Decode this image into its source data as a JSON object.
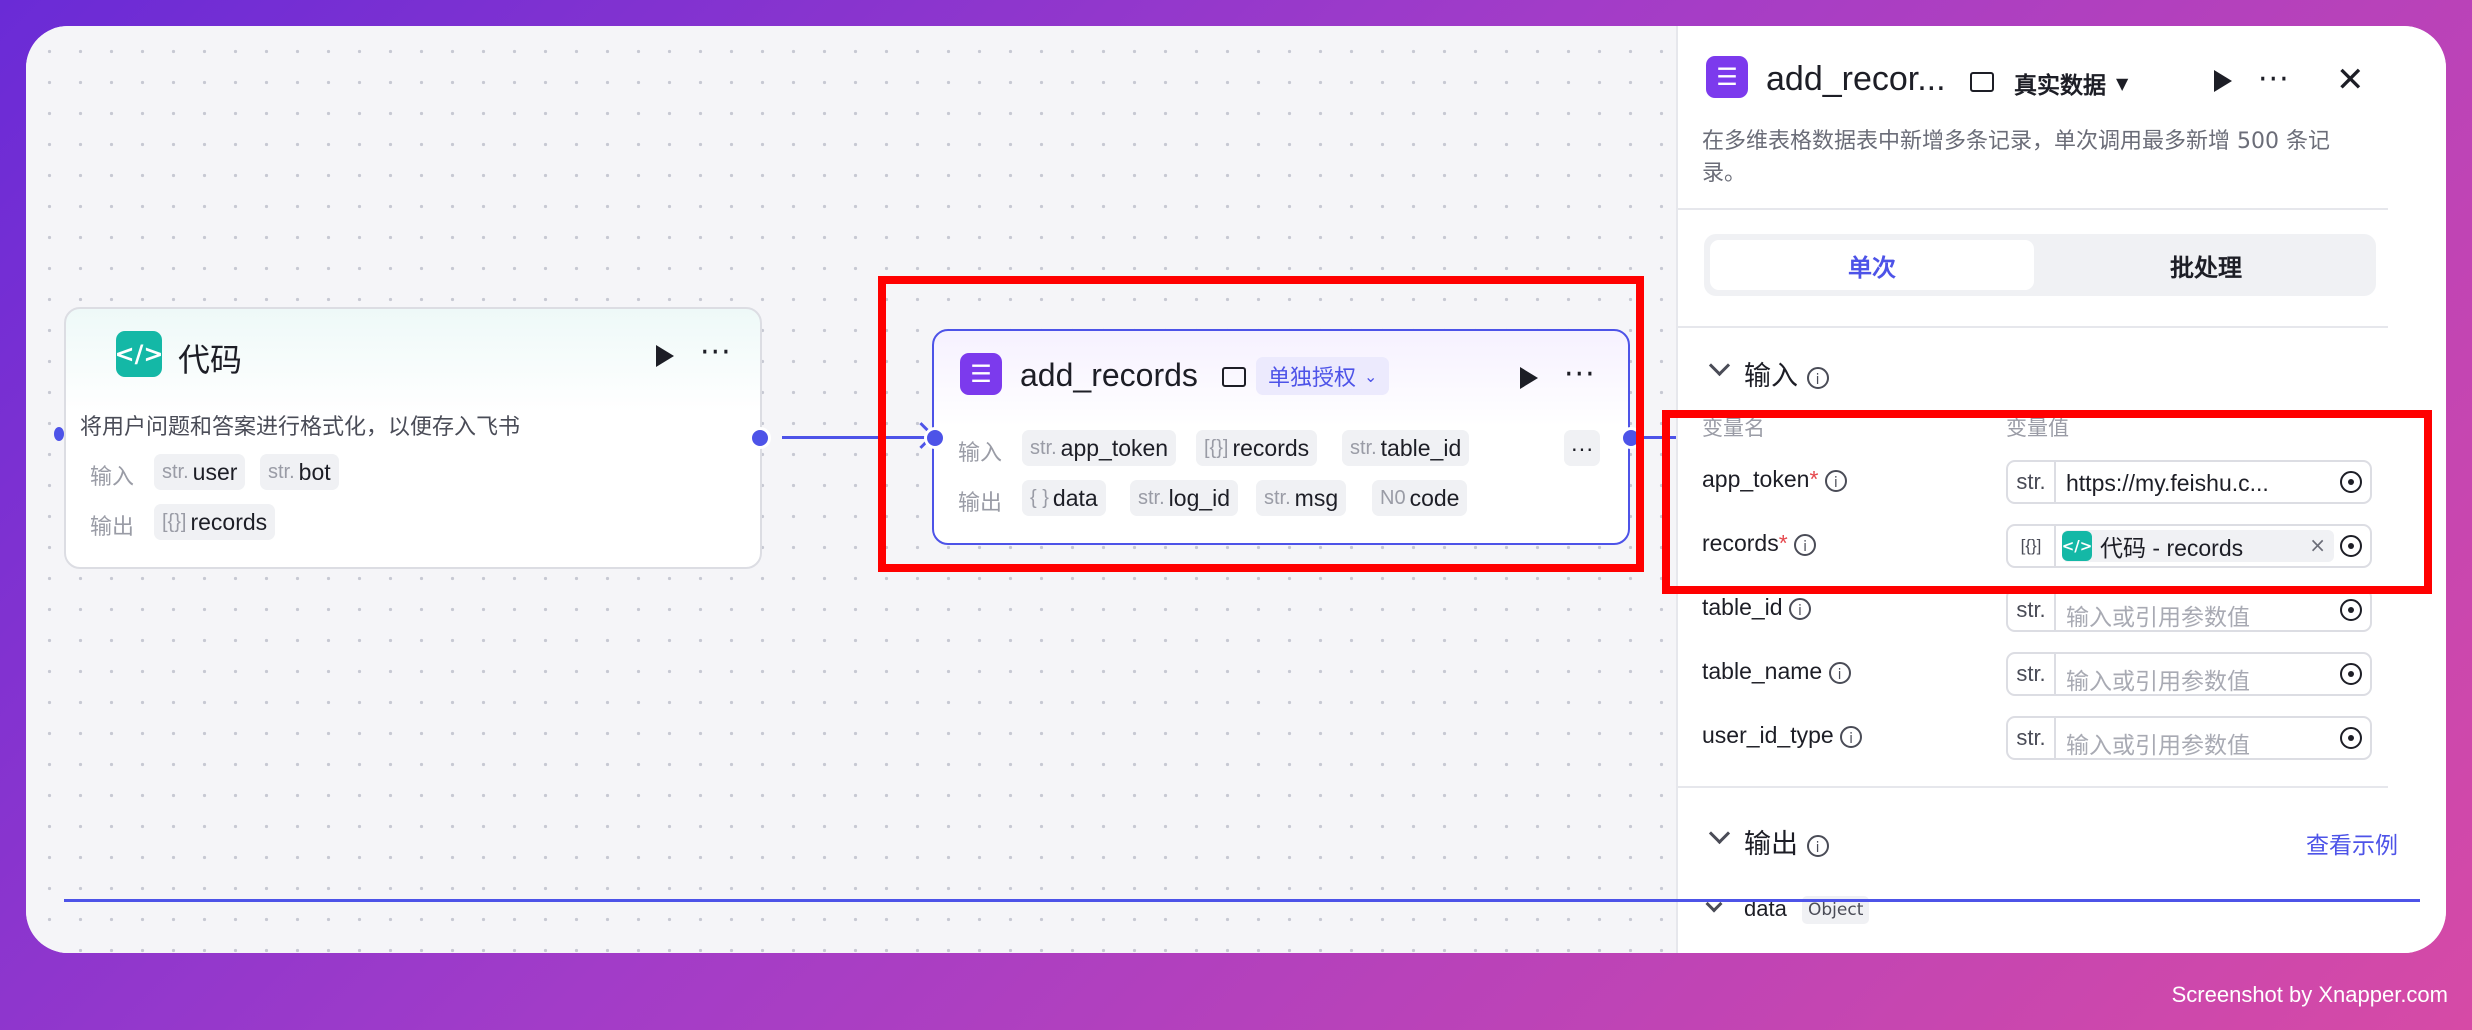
{
  "code_node": {
    "title": "代码",
    "description": "将用户问题和答案进行格式化，以便存入飞书",
    "input_label": "输入",
    "output_label": "输出",
    "inputs": [
      {
        "type": "str.",
        "name": "user"
      },
      {
        "type": "str.",
        "name": "bot"
      }
    ],
    "outputs": [
      {
        "type": "[{}]",
        "name": "records"
      }
    ]
  },
  "records_node": {
    "title": "add_records",
    "auth_label": "单独授权",
    "input_label": "输入",
    "output_label": "输出",
    "inputs": [
      {
        "type": "str.",
        "name": "app_token"
      },
      {
        "type": "[{}]",
        "name": "records"
      },
      {
        "type": "str.",
        "name": "table_id"
      }
    ],
    "outputs": [
      {
        "type": "{ }",
        "name": "data"
      },
      {
        "type": "str.",
        "name": "log_id"
      },
      {
        "type": "str.",
        "name": "msg"
      },
      {
        "type": "N0",
        "name": "code"
      }
    ],
    "more": "···"
  },
  "panel": {
    "title": "add_recor...",
    "mode": "真实数据",
    "description": "在多维表格数据表中新增多条记录，单次调用最多新增 500 条记录。",
    "tabs": [
      "单次",
      "批处理"
    ],
    "input_section": "输入",
    "col_name": "变量名",
    "col_value": "变量值",
    "params": [
      {
        "name": "app_token",
        "required": "*",
        "type": "str.",
        "value": "https://my.feishu.c..."
      },
      {
        "name": "records",
        "required": "*",
        "type": "[{}]",
        "value": "代码 - records"
      },
      {
        "name": "table_id",
        "required": "",
        "type": "str.",
        "placeholder": "输入或引用参数值"
      },
      {
        "name": "table_name",
        "required": "",
        "type": "str.",
        "placeholder": "输入或引用参数值"
      },
      {
        "name": "user_id_type",
        "required": "",
        "type": "str.",
        "placeholder": "输入或引用参数值"
      }
    ],
    "output_section": "输出",
    "view_example": "查看示例",
    "output_field": "data",
    "output_field_type": "Object"
  },
  "watermark": "Screenshot by Xnapper.com",
  "colors": {
    "accent": "#4d53e8",
    "highlight": "#ff0000",
    "code_icon": "#14b8a6",
    "table_icon": "#7c3aed"
  }
}
